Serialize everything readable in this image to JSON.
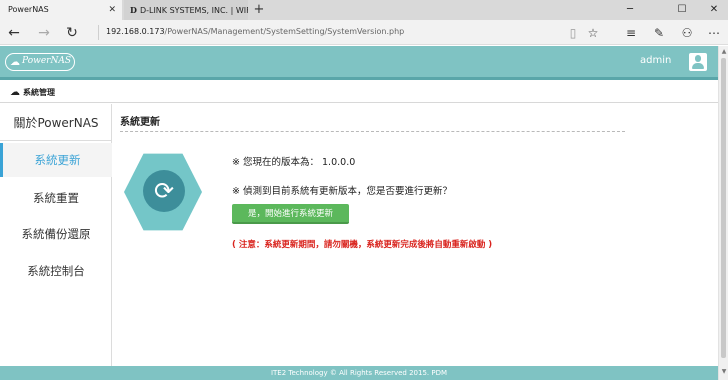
{
  "browser": {
    "tabs": [
      {
        "title": "PowerNAS",
        "active": true
      },
      {
        "title": "D-LINK SYSTEMS, INC. | WIF",
        "active": false,
        "favicon": "D"
      }
    ],
    "url_host": "192.168.0.173",
    "url_path": "/PowerNAS/Management/SystemSetting/SystemVersion.php"
  },
  "header": {
    "logo_text": "PowerNAS",
    "user": "admin"
  },
  "breadcrumb": "系統管理",
  "sidebar": {
    "title": "關於PowerNAS",
    "items": [
      {
        "label": "系統更新",
        "active": true
      },
      {
        "label": "系統重置",
        "active": false
      },
      {
        "label": "系統備份還原",
        "active": false
      },
      {
        "label": "系統控制台",
        "active": false
      }
    ]
  },
  "main": {
    "section_title": "系統更新",
    "current_version_label": "※ 您現在的版本為：",
    "current_version": "1.0.0.0",
    "update_prompt": "※ 偵測到目前系統有更新版本，您是否要進行更新？",
    "update_button": "是，開始進行系統更新",
    "notice": "( 注意：系統更新期間，請勿關機，系統更新完成後將自動重新啟動 )"
  },
  "footer": "ITE2 Technology © All Rights Reserved 2015. PDM",
  "colors": {
    "header": "#7fc3c3",
    "accent": "#3aa3d6",
    "button": "#5cb85c",
    "notice": "#d9231d"
  }
}
